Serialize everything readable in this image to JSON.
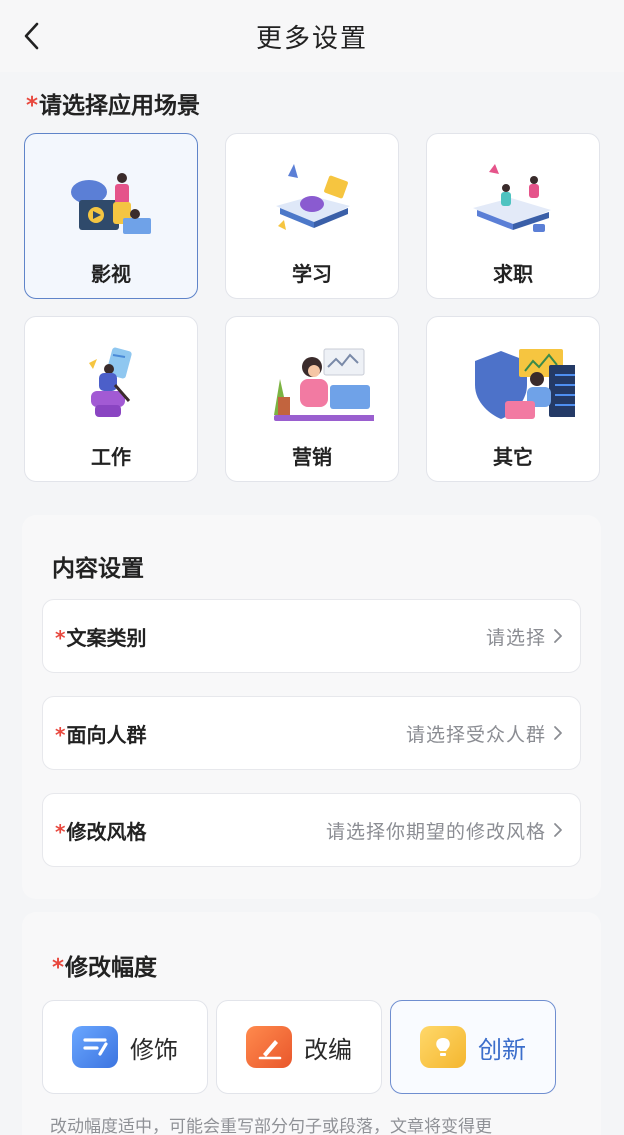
{
  "header": {
    "title": "更多设置"
  },
  "scene": {
    "required_mark": "*",
    "title": "请选择应用场景",
    "items": [
      {
        "label": "影视"
      },
      {
        "label": "学习"
      },
      {
        "label": "求职"
      },
      {
        "label": "工作"
      },
      {
        "label": "营销"
      },
      {
        "label": "其它"
      }
    ],
    "selected": "影视"
  },
  "content_settings": {
    "title": "内容设置",
    "rows": [
      {
        "label": "文案类别",
        "value": "请选择"
      },
      {
        "label": "面向人群",
        "value": "请选择受众人群"
      },
      {
        "label": "修改风格",
        "value": "请选择你期望的修改风格"
      }
    ]
  },
  "degree": {
    "title": "修改幅度",
    "options": [
      {
        "label": "修饰",
        "icon": "pen-stroke-icon",
        "color": "#4f8ff0"
      },
      {
        "label": "改编",
        "icon": "pencil-icon",
        "color": "#f0703a"
      },
      {
        "label": "创新",
        "icon": "lightbulb-icon",
        "color": "#f6c540"
      }
    ],
    "selected": "创新",
    "note": "改动幅度适中，可能会重写部分句子或段落，文章将变得更"
  },
  "colors": {
    "accent": "#5f84c9",
    "required": "#e8483e"
  }
}
